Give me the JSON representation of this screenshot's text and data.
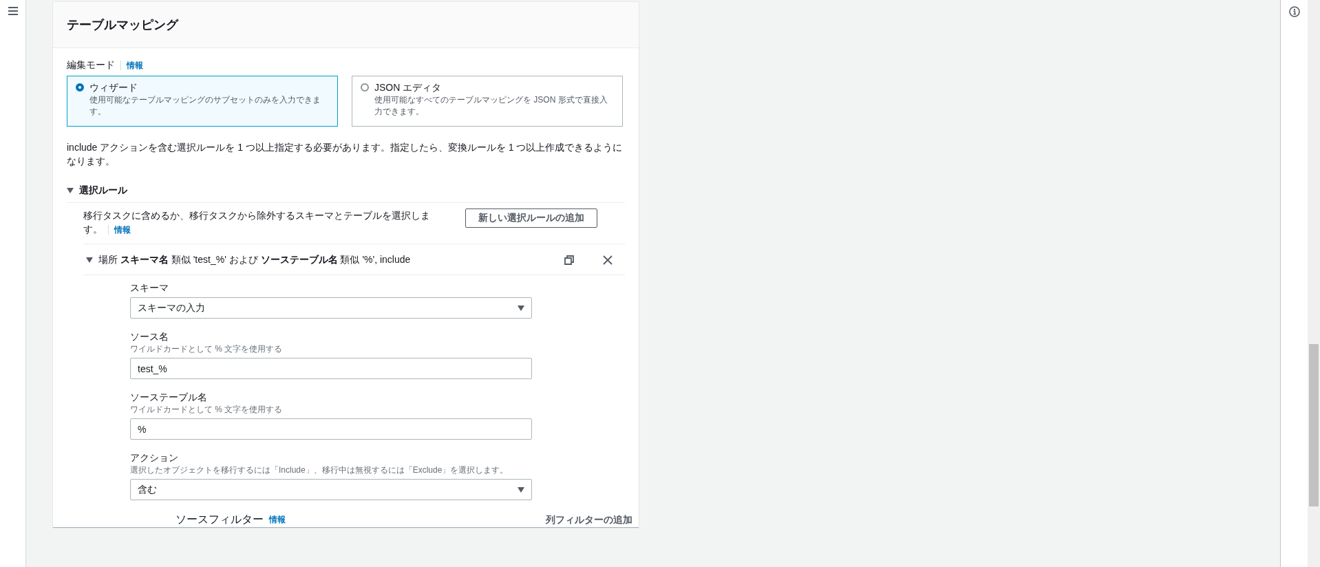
{
  "panel": {
    "title": "テーブルマッピング"
  },
  "edit_mode": {
    "label": "編集モード",
    "info_link": "情報",
    "options": [
      {
        "title": "ウィザード",
        "description": "使用可能なテーブルマッピングのサブセットのみを入力できます。",
        "selected": true
      },
      {
        "title": "JSON エディタ",
        "description": "使用可能なすべてのテーブルマッピングを JSON 形式で直接入力できます。",
        "selected": false
      }
    ]
  },
  "notice": "include アクションを含む選択ルールを 1 つ以上指定する必要があります。指定したら、変換ルールを 1 つ以上作成できるようになります。",
  "selection_rules": {
    "title": "選択ルール",
    "expanded": true,
    "description": "移行タスクに含めるか、移行タスクから除外するスキーマとテーブルを選択します。",
    "info_link": "情報",
    "add_button": "新しい選択ルールの追加",
    "rules": [
      {
        "expanded": true,
        "summary": "場所 **スキーマ名** 類似 'test_%' および **ソーステーブル名** 類似 '%', include",
        "fields": [
          {
            "kind": "select",
            "label": "スキーマ",
            "value": "スキーマの入力"
          },
          {
            "kind": "input",
            "label": "ソース名",
            "description": "ワイルドカードとして % 文字を使用する",
            "value": "test_%"
          },
          {
            "kind": "input",
            "label": "ソーステーブル名",
            "description": "ワイルドカードとして % 文字を使用する",
            "value": "%"
          },
          {
            "kind": "select",
            "label": "アクション",
            "description": "選択したオブジェクトを移行するには「Include」、移行中は無視するには「Exclude」を選択します。",
            "value": "含む"
          }
        ],
        "source_filter": {
          "label": "ソースフィルター",
          "info_link": "情報",
          "add_button": "列フィルターの追加"
        }
      }
    ]
  }
}
